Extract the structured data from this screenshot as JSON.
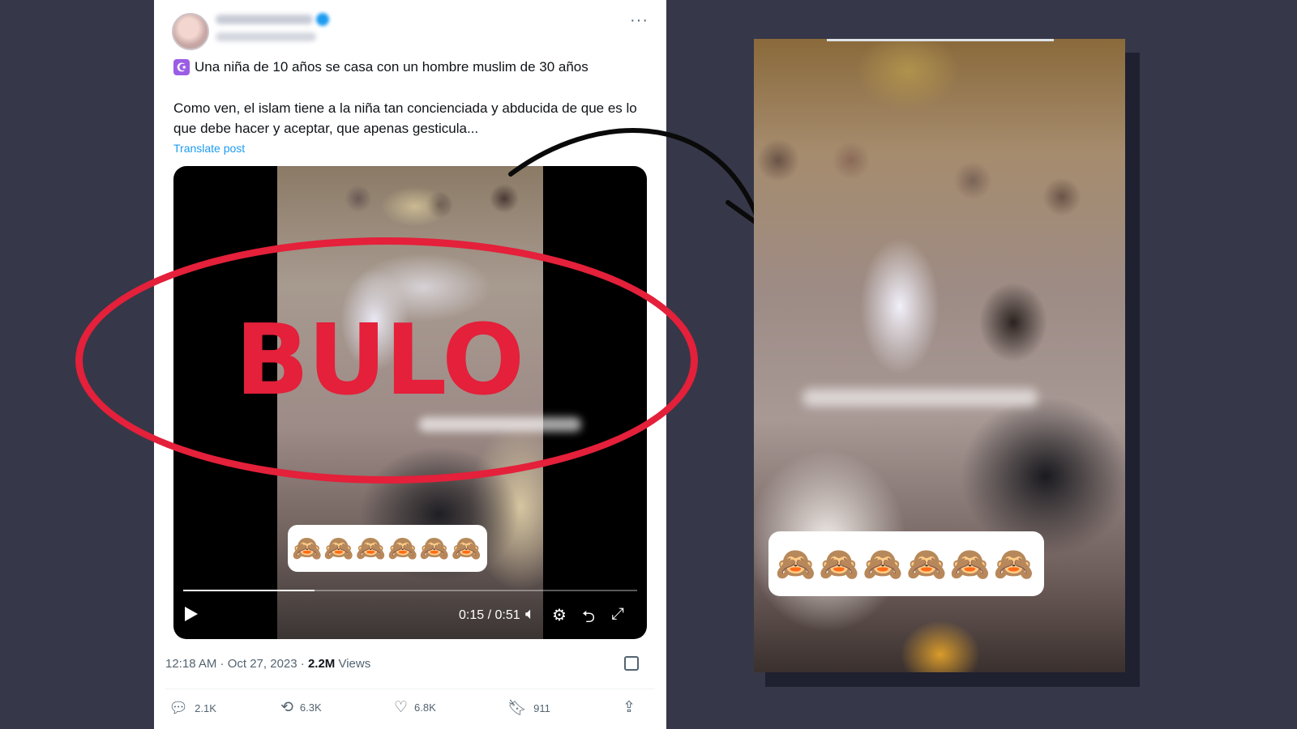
{
  "tweet": {
    "text_line1": "Una niña de 10 años se casa con un hombre muslim de 30 años",
    "text_body": "Como ven, el islam tiene a la niña tan concienciada y abducida de que es lo que debe hacer y aceptar, que apenas gesticula...",
    "translate_label": "Translate post",
    "video": {
      "time": "0:15 / 0:51",
      "progress_fraction": 0.29,
      "emoji": "🙈🙈🙈🙈🙈🙈"
    },
    "timestamp": "12:18 AM · Oct 27, 2023 · ",
    "views_count": "2.2M",
    "views_label": " Views",
    "actions": {
      "replies": "2.1K",
      "reposts": "6.3K",
      "likes": "6.8K",
      "bookmarks": "911"
    }
  },
  "stamp": {
    "text": "BULO",
    "color": "#e4203a"
  },
  "zoom": {
    "emoji": "🙈🙈🙈🙈🙈🙈"
  },
  "colors": {
    "background": "#363849",
    "link": "#1d9bf0",
    "text": "#0f1419",
    "muted": "#536471"
  }
}
